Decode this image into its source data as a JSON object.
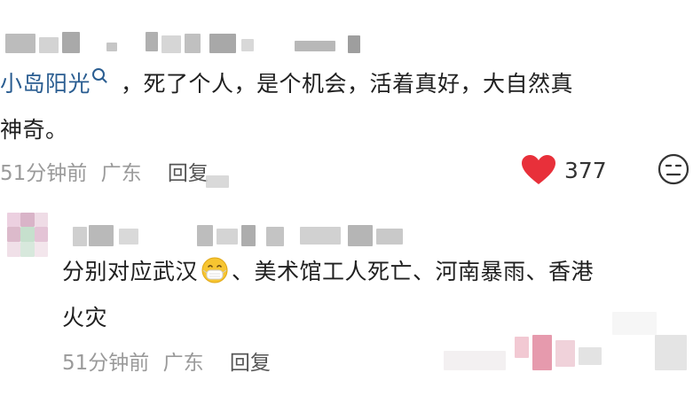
{
  "comments": [
    {
      "mention": "小岛阳光",
      "text_line1": "，死了个人，是个机会，活着真好，大自然真",
      "text_line2": "神奇。",
      "time": "51分钟前",
      "location": "广东",
      "reply_label": "回复",
      "likes": "377"
    },
    {
      "text_before_emoji": "分别对应武汉",
      "text_after_emoji": "、美术馆工人死亡、河南暴雨、香港",
      "text_line2": "火灾",
      "emoji": "mask-face-emoji",
      "time": "51分钟前",
      "location": "广东",
      "reply_label": "回复"
    }
  ],
  "icons": {
    "like": "heart-icon",
    "emoji": "emoji-face-icon",
    "search": "search-icon"
  },
  "colors": {
    "heart": "#e8303a",
    "mention": "#2a5d91",
    "meta": "#9a9a9a"
  }
}
